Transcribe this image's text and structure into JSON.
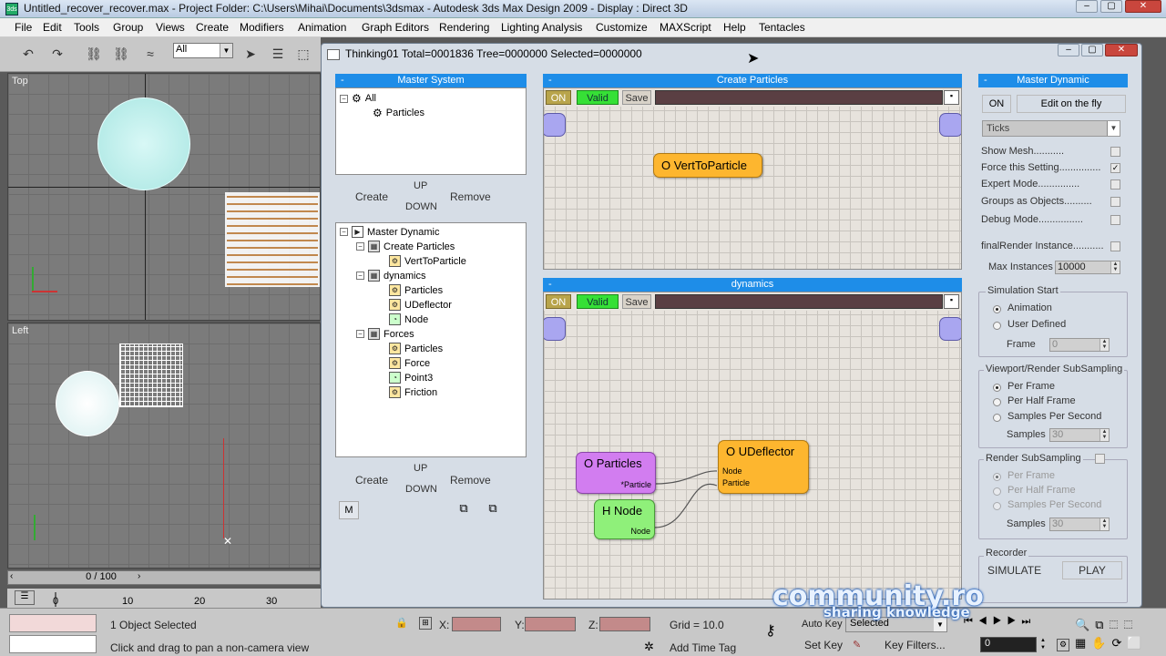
{
  "window": {
    "title": "Untitled_recover_recover.max     - Project Folder: C:\\Users\\Mihai\\Documents\\3dsmax     - Autodesk 3ds Max Design 2009     - Display : Direct 3D"
  },
  "menu": [
    "File",
    "Edit",
    "Tools",
    "Group",
    "Views",
    "Create",
    "Modifiers",
    "Animation",
    "Graph Editors",
    "Rendering",
    "Lighting Analysis",
    "Customize",
    "MAXScript",
    "Help",
    "Tentacles"
  ],
  "toolbar": {
    "selection_filter": "All"
  },
  "viewports": {
    "top_label": "Top",
    "left_label": "Left"
  },
  "timeline": {
    "counter": "0 / 100",
    "ticks": [
      "0",
      "10",
      "20",
      "30"
    ]
  },
  "thinking": {
    "title": "Thinking01  Total=0001836  Tree=0000000  Selected=0000000",
    "master_system": {
      "header": "Master System",
      "items": [
        "All",
        "Particles"
      ],
      "create": "Create",
      "up": "UP",
      "down": "DOWN",
      "remove": "Remove"
    },
    "master_dynamic_tree": {
      "items": [
        "Master Dynamic",
        "Create Particles",
        "VertToParticle",
        "dynamics",
        "Particles",
        "UDeflector",
        "Node",
        "Forces",
        "Particles",
        "Force",
        "Point3",
        "Friction"
      ],
      "create": "Create",
      "up": "UP",
      "down": "DOWN",
      "remove": "Remove",
      "m": "M"
    },
    "create_particles": {
      "header": "Create Particles",
      "on": "ON",
      "valid": "Valid",
      "save": "Save",
      "node": "O VertToParticle"
    },
    "dynamics": {
      "header": "dynamics",
      "on": "ON",
      "valid": "Valid",
      "save": "Save",
      "nodes": {
        "particles": {
          "title": "O Particles",
          "port": "*Particle"
        },
        "hnode": {
          "title": "H Node",
          "port": "Node"
        },
        "udeflector": {
          "title": "O UDeflector",
          "port1": "Node",
          "port2": "Particle"
        }
      }
    },
    "master_dynamic": {
      "header": "Master Dynamic",
      "on": "ON",
      "edit": "Edit on the fly",
      "ticks": "Ticks",
      "options": [
        "Show Mesh...........",
        "Force this Setting...............",
        "Expert Mode...............",
        "Groups as Objects..........",
        "Debug Mode................"
      ],
      "final_render": "finalRender Instance...........",
      "max_instances_label": "Max Instances",
      "max_instances": "10000",
      "sim_start": {
        "title": "Simulation Start",
        "opt1": "Animation",
        "opt2": "User Defined",
        "frame_label": "Frame",
        "frame": "0"
      },
      "viewport_sub": {
        "title": "Viewport/Render SubSampling",
        "opt1": "Per Frame",
        "opt2": "Per Half Frame",
        "opt3": "Samples Per Second",
        "samples_label": "Samples",
        "samples": "30"
      },
      "render_sub": {
        "title": "Render SubSampling",
        "opt1": "Per Frame",
        "opt2": "Per Half Frame",
        "opt3": "Samples Per Second",
        "samples_label": "Samples",
        "samples": "30"
      },
      "recorder": {
        "title": "Recorder",
        "simulate": "SIMULATE",
        "play": "PLAY"
      }
    }
  },
  "status": {
    "selected": "1 Object Selected",
    "prompt": "Click and drag to pan a non-camera view",
    "x_label": "X:",
    "y_label": "Y:",
    "z_label": "Z:",
    "grid": "Grid = 10.0",
    "add_time_tag": "Add Time Tag",
    "auto_key": "Auto Key",
    "selected_drop": "Selected",
    "set_key": "Set Key",
    "key_filters": "Key Filters...",
    "frame": "0"
  },
  "watermark": {
    "line1": "community.ro",
    "line2": "sharing knowledge"
  }
}
